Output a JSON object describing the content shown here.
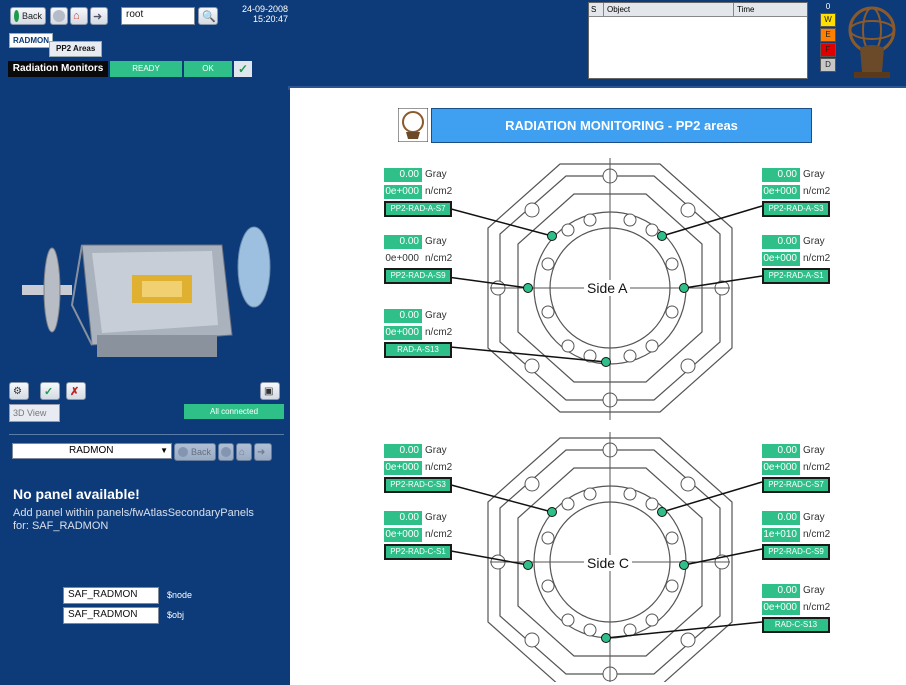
{
  "toolbar": {
    "back_label": "Back",
    "user_value": "root",
    "date": "24-09-2008",
    "time": "15:20:47"
  },
  "tabs": {
    "radmon_label": "RADMON",
    "pp2_label": "PP2 Areas"
  },
  "status_row": {
    "title": "Radiation Monitors",
    "state": "READY",
    "status": "OK",
    "check_glyph": "✓"
  },
  "alarm_table": {
    "columns": [
      "S",
      "Object",
      "Time"
    ]
  },
  "severity": {
    "count": "0",
    "levels": [
      {
        "label": "W",
        "color": "#ffe000"
      },
      {
        "label": "E",
        "color": "#ff8000"
      },
      {
        "label": "F",
        "color": "#e00000"
      },
      {
        "label": "D",
        "color": "#c8c8c8"
      }
    ]
  },
  "left_panel": {
    "view_label": "3D View",
    "connection_status": "All connected",
    "dropdown_value": "RADMON",
    "nav_back_label": "Back",
    "no_panel_title": "No panel available!",
    "no_panel_text_1": "Add panel within panels/fwAtlasSecondaryPanels",
    "no_panel_text_2": "for: SAF_RADMON",
    "node_value": "SAF_RADMON",
    "node_label": "$node",
    "obj_value": "SAF_RADMON",
    "obj_label": "$obj"
  },
  "main": {
    "title": "RADIATION MONITORING - PP2 areas",
    "side_a_label": "Side A",
    "side_c_label": "Side C",
    "dose_unit": "Gray",
    "fluence_unit": "n/cm2"
  },
  "sensors": [
    {
      "id": "PP2-RAD-A-S7",
      "dose": "0.00",
      "fluence": "0e+000"
    },
    {
      "id": "PP2-RAD-A-S3",
      "dose": "0.00",
      "fluence": "0e+000"
    },
    {
      "id": "PP2-RAD-A-S9",
      "dose": "0.00",
      "fluence": "0e+000"
    },
    {
      "id": "PP2-RAD-A-S1",
      "dose": "0.00",
      "fluence": "0e+000"
    },
    {
      "id": "RAD-A-S13",
      "dose": "0.00",
      "fluence": "0e+000"
    },
    {
      "id": "PP2-RAD-C-S3",
      "dose": "0.00",
      "fluence": "0e+000"
    },
    {
      "id": "PP2-RAD-C-S7",
      "dose": "0.00",
      "fluence": "0e+000"
    },
    {
      "id": "PP2-RAD-C-S1",
      "dose": "0.00",
      "fluence": "0e+000"
    },
    {
      "id": "PP2-RAD-C-S9",
      "dose": "0.00",
      "fluence": "1e+010"
    },
    {
      "id": "RAD-C-S13",
      "dose": "0.00",
      "fluence": "0e+000"
    }
  ],
  "icons": {
    "back": "back-arrow-icon",
    "stop": "stop-icon",
    "home": "home-icon",
    "forward": "forward-arrow-icon",
    "search": "search-icon",
    "atlas_logo": "atlas-logo"
  }
}
